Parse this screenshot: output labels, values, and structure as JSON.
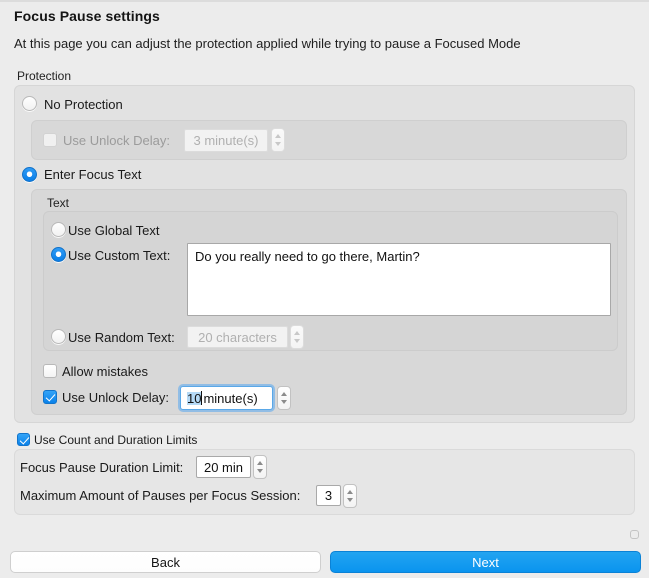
{
  "window": {
    "title": "Focus Pause settings",
    "subtitle": "At this page you can adjust the protection applied while trying to pause a Focused Mode"
  },
  "protection": {
    "group_label": "Protection",
    "no_protection": {
      "label": "No Protection",
      "selected": false
    },
    "no_protection_delay": {
      "checkbox_label": "Use Unlock Delay:",
      "checked": false,
      "enabled": false,
      "value": "3 minute(s)"
    },
    "enter_focus_text": {
      "label": "Enter Focus Text",
      "selected": true
    },
    "text_group": {
      "group_label": "Text",
      "use_global_text": {
        "label": "Use Global Text",
        "selected": false
      },
      "use_custom_text": {
        "label": "Use Custom Text:",
        "selected": true,
        "value": "Do you really need to go there, Martin?"
      },
      "use_random_text": {
        "label": "Use Random Text:",
        "selected": false,
        "value": "20 characters"
      }
    },
    "allow_mistakes": {
      "label": "Allow mistakes",
      "checked": false
    },
    "unlock_delay": {
      "label": "Use Unlock Delay:",
      "checked": true,
      "value_selected": "10",
      "value_rest": " minute(s)"
    }
  },
  "limits": {
    "toggle_label": "Use Count and Duration Limits",
    "toggle_checked": true,
    "duration_limit": {
      "label": "Focus Pause Duration Limit:",
      "value": "20 min"
    },
    "max_pauses": {
      "label": "Maximum Amount of Pauses per Focus Session:",
      "value": "3"
    }
  },
  "footer": {
    "back_label": "Back",
    "next_label": "Next"
  },
  "colors": {
    "accent": "#0a8cee",
    "window_bg": "#ececec",
    "group_bg": "#e2e2e2"
  }
}
